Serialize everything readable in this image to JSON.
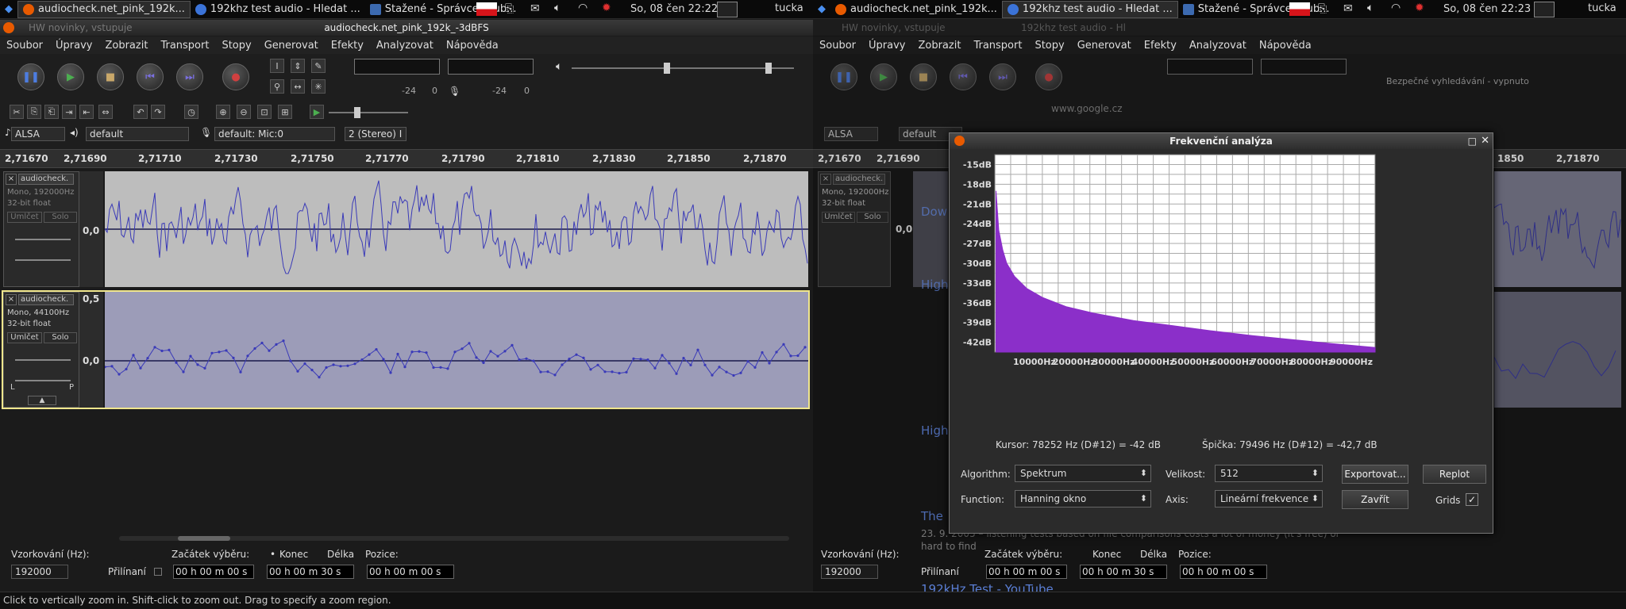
{
  "left": {
    "taskbar": {
      "items": [
        {
          "label": "audiocheck.net_pink_192k..."
        },
        {
          "label": "192khz test audio - Hledat ..."
        },
        {
          "label": "Stažené - Správce soub..."
        }
      ],
      "datetime": "So, 08 čen  22:22",
      "user": "tucka"
    },
    "background_tab": "HW novinky, vstupuje",
    "window_title": "audiocheck.net_pink_192k_-3dBFS",
    "menu": [
      "Soubor",
      "Úpravy",
      "Zobrazit",
      "Transport",
      "Stopy",
      "Generovat",
      "Efekty",
      "Analyzovat",
      "Nápověda"
    ],
    "meter_labels": [
      "-24",
      "0",
      "-24",
      "0"
    ],
    "device": {
      "host": "ALSA",
      "output": "default",
      "input": "default: Mic:0",
      "channels": "2 (Stereo) I"
    },
    "ruler": [
      "2,71670",
      "2,71690",
      "2,71710",
      "2,71730",
      "2,71750",
      "2,71770",
      "2,71790",
      "2,71810",
      "2,71830",
      "2,71850",
      "2,71870"
    ],
    "track1": {
      "name": "audiocheck.",
      "info1": "Mono, 192000Hz",
      "info2": "32-bit float",
      "mute": "Umlčet",
      "solo": "Solo",
      "scale": "0,0"
    },
    "track2": {
      "name": "audiocheck.",
      "info1": "Mono, 44100Hz",
      "info2": "32-bit float",
      "mute": "Umlčet",
      "solo": "Solo",
      "scale_top": "0,5",
      "scale": "0,0"
    },
    "bottom": {
      "rate_label": "Vzorkování (Hz):",
      "rate_value": "192000",
      "snap_label": "Přilínaní",
      "selection_start_label": "Začátek výběru:",
      "end_label": "Konec",
      "length_label": "Délka",
      "position_label": "Pozice:",
      "time1": "00 h 00 m 00 s",
      "time2": "00 h 00 m 30 s",
      "time3": "00 h 00 m 00 s"
    },
    "status": "Click to vertically zoom in. Shift-click to zoom out. Drag to specify a zoom region.",
    "pan_labels": [
      "L",
      "P"
    ]
  },
  "right": {
    "taskbar": {
      "items": [
        {
          "label": "audiocheck.net_pink_192k..."
        },
        {
          "label": "192khz test audio - Hledat ..."
        },
        {
          "label": "Stažené - Správce soub..."
        }
      ],
      "datetime": "So, 08 čen  22:23",
      "user": "tucka"
    },
    "background_tabs": [
      "HW novinky, vstupuje",
      "192khz test audio - Hl"
    ],
    "menu": [
      "Soubor",
      "Úpravy",
      "Zobrazit",
      "Transport",
      "Stopy",
      "Generovat",
      "Efekty",
      "Analyzovat",
      "Nápověda"
    ],
    "device": {
      "host": "ALSA",
      "output": "default"
    },
    "ruler": [
      "2,71670",
      "2,71690",
      "1850",
      "2,71870"
    ],
    "track1": {
      "name": "audiocheck.",
      "info1": "Mono, 192000Hz",
      "info2": "32-bit float",
      "mute": "Umlčet",
      "solo": "Solo",
      "scale": "0,0"
    },
    "bottom": {
      "rate_label": "Vzorkování (Hz):",
      "rate_value": "192000",
      "snap_label": "Přilínaní",
      "selection_start_label": "Začátek výběru:",
      "end_label": "Konec",
      "length_label": "Délka",
      "position_label": "Pozice:",
      "time1": "00 h 00 m 00 s",
      "time2": "00 h 00 m 30 s",
      "time3": "00 h 00 m 00 s"
    },
    "browser_bits": {
      "google_url": "www.google.cz",
      "safe_search": "Bezpečné vyhledávání - vypnuto",
      "results": [
        "High",
        "High",
        "The",
        "192kHz Test - YouTube"
      ],
      "snippet1": "23. 9. 2005 – listening tests based on file comparisons costs a lot of money (it's free) or",
      "snippet2": "hard to find",
      "dow": "Dow"
    },
    "dialog": {
      "title": "Frekvenční analýza",
      "cursor_text": "Kursor: 78252 Hz (D#12) = -42 dB",
      "peak_text": "Špička: 79496 Hz (D#12) = -42,7 dB",
      "algorithm_label": "Algorithm:",
      "algorithm_value": "Spektrum",
      "size_label": "Velikost:",
      "size_value": "512",
      "function_label": "Function:",
      "function_value": "Hanning okno",
      "axis_label": "Axis:",
      "axis_value": "Lineární frekvence",
      "export_label": "Exportovat...",
      "replot_label": "Replot",
      "close_label": "Zavřít",
      "grids_label": "Grids",
      "grids_checked": "✓"
    }
  },
  "chart_data": {
    "type": "area",
    "title": "Frekvenční analýza",
    "xlabel": "",
    "ylabel": "",
    "x_ticks": [
      "10000Hz",
      "20000Hz",
      "30000Hz",
      "40000Hz",
      "50000Hz",
      "60000Hz",
      "70000Hz",
      "80000Hz",
      "90000Hz"
    ],
    "y_ticks": [
      "-15dB",
      "-18dB",
      "-21dB",
      "-24dB",
      "-27dB",
      "-30dB",
      "-33dB",
      "-36dB",
      "-39dB",
      "-42dB"
    ],
    "xlim": [
      0,
      96000
    ],
    "ylim": [
      -43.5,
      -13.5
    ],
    "grid": true,
    "series": [
      {
        "color": "#8b2fc9",
        "x": [
          300,
          1000,
          2000,
          3000,
          5000,
          8000,
          12000,
          18000,
          25000,
          35000,
          45000,
          55000,
          65000,
          75000,
          85000,
          96000
        ],
        "y": [
          -19,
          -25,
          -28,
          -30,
          -32,
          -33.8,
          -35.2,
          -36.6,
          -37.6,
          -38.7,
          -39.5,
          -40.3,
          -41,
          -41.6,
          -42.2,
          -42.8
        ]
      }
    ],
    "grid_color": "#aaaaaa"
  },
  "colors": {
    "accent": "#8b2fc9",
    "wave": "#3a3ab8",
    "track_bg1": "#bdbdbd",
    "track_bg2": "#9c9cb8"
  }
}
